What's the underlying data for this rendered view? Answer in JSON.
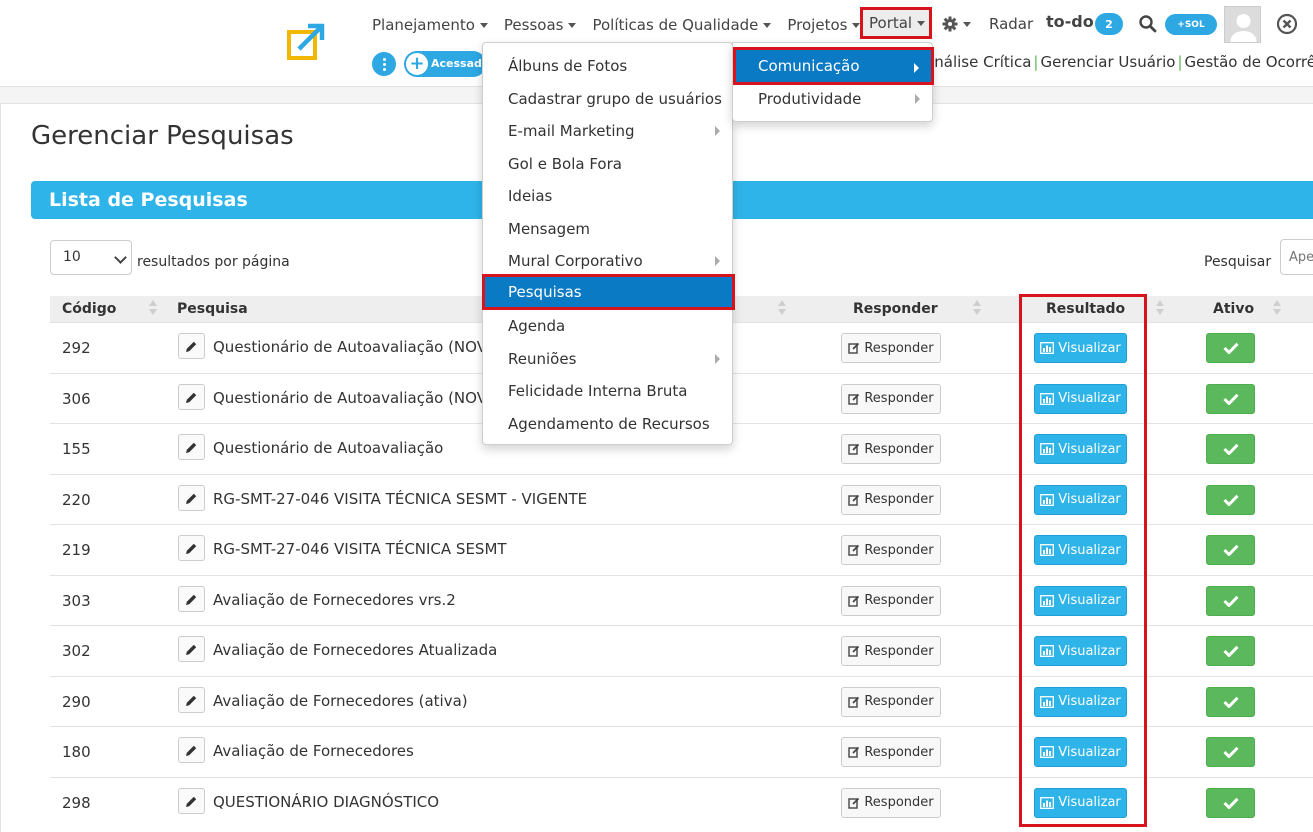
{
  "nav": {
    "menu": [
      {
        "label": "Planejamento"
      },
      {
        "label": "Pessoas"
      },
      {
        "label": "Políticas de Qualidade"
      },
      {
        "label": "Projetos"
      }
    ],
    "portal_label": "Portal",
    "radar_label": "Radar",
    "todo_label": "to-do",
    "todo_count": "2",
    "sol_label": "+SOL",
    "acessos_label": "Acessados",
    "shortcuts": [
      "Análise Crítica",
      "Gerenciar Usuário",
      "Gestão de Ocorrências"
    ]
  },
  "portal_menu": {
    "items": [
      {
        "label": "Álbuns de Fotos",
        "submenu": false
      },
      {
        "label": "Cadastrar grupo de usuários",
        "submenu": false
      },
      {
        "label": "E-mail Marketing",
        "submenu": true
      },
      {
        "label": "Gol e Bola Fora",
        "submenu": false
      },
      {
        "label": "Ideias",
        "submenu": false
      },
      {
        "label": "Mensagem",
        "submenu": false
      },
      {
        "label": "Mural Corporativo",
        "submenu": true
      },
      {
        "label": "Pesquisas",
        "submenu": false,
        "active": true
      },
      {
        "label": "Agenda",
        "submenu": false
      },
      {
        "label": "Reuniões",
        "submenu": true
      },
      {
        "label": "Felicidade Interna Bruta",
        "submenu": false
      },
      {
        "label": "Agendamento de Recursos",
        "submenu": false
      }
    ],
    "sections": [
      {
        "label": "Comunicação",
        "active": true
      },
      {
        "label": "Produtividade",
        "active": false
      }
    ]
  },
  "page": {
    "title": "Gerenciar Pesquisas",
    "list_title": "Lista de Pesquisas",
    "page_length": "10",
    "per_page_label": "resultados por página",
    "search_label": "Pesquisar",
    "search_placeholder": "Ape"
  },
  "table": {
    "headers": {
      "codigo": "Código",
      "pesquisa": "Pesquisa",
      "responder": "Responder",
      "resultado": "Resultado",
      "ativo": "Ativo"
    },
    "responder_label": "Responder",
    "visualizar_label": "Visualizar",
    "rows": [
      {
        "code": "292",
        "title": "Questionário de Autoavaliação (NOVO)"
      },
      {
        "code": "306",
        "title": "Questionário de Autoavaliação (NOVO)"
      },
      {
        "code": "155",
        "title": "Questionário de Autoavaliação"
      },
      {
        "code": "220",
        "title": "RG-SMT-27-046 VISITA TÉCNICA SESMT - VIGENTE"
      },
      {
        "code": "219",
        "title": "RG-SMT-27-046 VISITA TÉCNICA SESMT"
      },
      {
        "code": "303",
        "title": "Avaliação de Fornecedores vrs.2"
      },
      {
        "code": "302",
        "title": "Avaliação de Fornecedores Atualizada"
      },
      {
        "code": "290",
        "title": "Avaliação de Fornecedores (ativa)"
      },
      {
        "code": "180",
        "title": "Avaliação de Fornecedores"
      },
      {
        "code": "298",
        "title": "QUESTIONÁRIO DIAGNÓSTICO"
      }
    ]
  },
  "colors": {
    "accent": "#2eb4e9",
    "menu_active": "#0a7ac4",
    "highlight": "#d7141e",
    "success": "#5cb85c"
  }
}
